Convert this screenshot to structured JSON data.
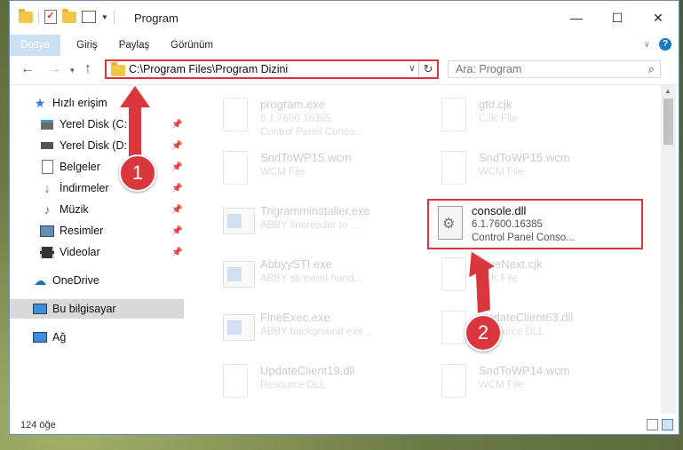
{
  "window": {
    "title": "Program",
    "min_glyph": "—",
    "max_glyph": "☐",
    "close_glyph": "✕"
  },
  "ribbon": {
    "tabs": [
      "Dosya",
      "Giriş",
      "Paylaş",
      "Görünüm"
    ]
  },
  "address": {
    "path": "C:\\Program Files\\Program Dizini",
    "search_placeholder": "Ara: Program"
  },
  "sidebar": {
    "items": [
      {
        "label": "Hızlı erişim",
        "icon": "star-icon",
        "pinned": false
      },
      {
        "label": "Yerel Disk (C:)",
        "icon": "drive-icon",
        "pinned": true
      },
      {
        "label": "Yerel Disk (D:)",
        "icon": "drive-icon",
        "pinned": true
      },
      {
        "label": "Belgeler",
        "icon": "documents-icon",
        "pinned": true
      },
      {
        "label": "İndirmeler",
        "icon": "download-icon",
        "pinned": true
      },
      {
        "label": "Müzik",
        "icon": "music-icon",
        "pinned": true
      },
      {
        "label": "Resimler",
        "icon": "pictures-icon",
        "pinned": true
      },
      {
        "label": "Videolar",
        "icon": "videos-icon",
        "pinned": true
      },
      {
        "label": "OneDrive",
        "icon": "onedrive-icon",
        "pinned": false
      },
      {
        "label": "Bu bilgisayar",
        "icon": "computer-icon",
        "pinned": false,
        "selected": true
      },
      {
        "label": "Ağ",
        "icon": "network-icon",
        "pinned": false
      }
    ]
  },
  "files": [
    {
      "name": "program.exe",
      "line1": "6.1.7600.16385",
      "line2": "Control Panel Conso...",
      "icon": "exe-icon"
    },
    {
      "name": "gtd.cjk",
      "line1": "CJK File",
      "line2": "",
      "icon": "document-icon"
    },
    {
      "name": "SndToWP15.wcm",
      "line1": "WCM File",
      "line2": "",
      "icon": "document-icon"
    },
    {
      "name": "SndToWP15.wcm",
      "line1": "WCM File",
      "line2": "",
      "icon": "document-icon"
    },
    {
      "name": "Trigramminstaller.exe",
      "line1": "ABBY finereader to ...",
      "line2": "",
      "icon": "app-icon"
    },
    {
      "name": "console.dll",
      "line1": "6.1.7600.16385",
      "line2": "Control Panel Conso...",
      "icon": "dll-icon",
      "highlighted": true
    },
    {
      "name": "AbbyySTI.exe",
      "line1": "ABBY sti event hand...",
      "line2": "",
      "icon": "app-icon"
    },
    {
      "name": "FineNext.cjk",
      "line1": "CJK File",
      "line2": "",
      "icon": "document-icon"
    },
    {
      "name": "FineExec.exe",
      "line1": "ABBY background exe...",
      "line2": "",
      "icon": "app-icon"
    },
    {
      "name": "UpdateClient63.dll",
      "line1": "Resource DLL",
      "line2": "",
      "icon": "dll-icon"
    },
    {
      "name": "UpdateClient19.dll",
      "line1": "Resource DLL",
      "line2": "",
      "icon": "dll-icon"
    },
    {
      "name": "SndToWP14.wcm",
      "line1": "WCM File",
      "line2": "",
      "icon": "document-icon"
    }
  ],
  "status": {
    "count": "124 öğe"
  },
  "annotations": {
    "step1": "1",
    "step2": "2",
    "accent_color": "#d9363e"
  }
}
